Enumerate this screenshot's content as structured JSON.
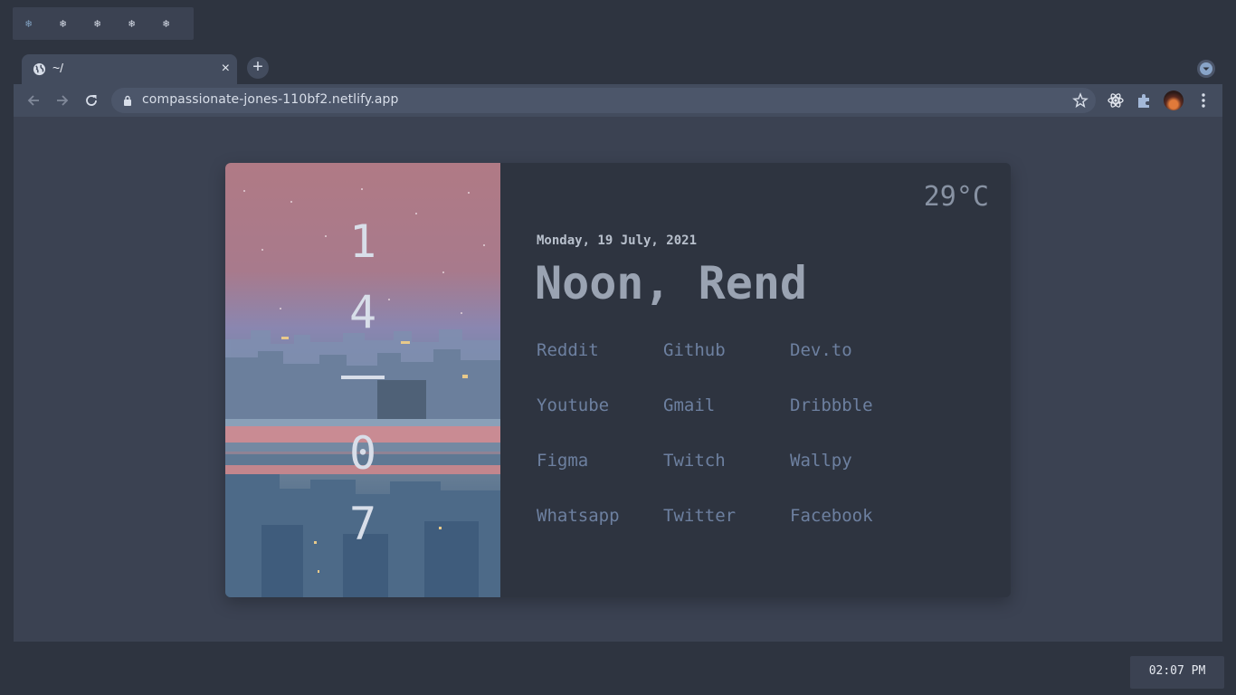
{
  "workspaces": [
    "❄",
    "❄",
    "❄",
    "❄",
    "❄"
  ],
  "browser": {
    "tab": {
      "title": "~/",
      "close": "×"
    },
    "new_tab": "+",
    "url": "compassionate-jones-110bf2.netlify.app"
  },
  "clock": {
    "h1": "1",
    "h2": "4",
    "m1": "0",
    "m2": "7"
  },
  "weather": {
    "temperature": "29°C"
  },
  "date": "Monday, 19 July, 2021",
  "greeting": "Noon, Rend",
  "links": [
    "Reddit",
    "Github",
    "Dev.to",
    "Youtube",
    "Gmail",
    "Dribbble",
    "Figma",
    "Twitch",
    "Wallpy",
    "Whatsapp",
    "Twitter",
    "Facebook"
  ],
  "taskbar": {
    "time": "02:07 PM"
  },
  "colors": {
    "accent": "#81a1c1",
    "background": "#2e3440",
    "panel": "#3b4252",
    "link": "#6d80a0"
  }
}
